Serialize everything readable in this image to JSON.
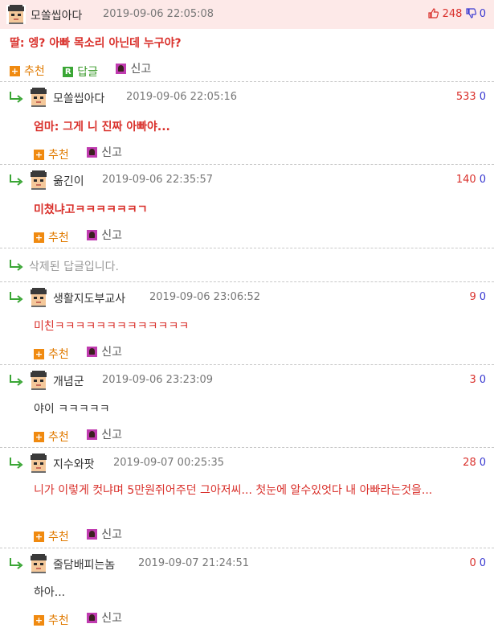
{
  "labels": {
    "recommend": "추천",
    "reply": "답글",
    "report": "신고"
  },
  "colors": {
    "up": "#d9302b",
    "down": "#3b3bd1",
    "top_bg": "#fde9e8"
  },
  "top": {
    "nick": "모쏠씹아다",
    "date": "2019-09-06 22:05:08",
    "up": "248",
    "down": "0",
    "text": "딸: 엥? 아빠 목소리 아닌데 누구야?"
  },
  "replies": [
    {
      "nick": "모쏠씹아다",
      "date": "2019-09-06 22:05:16",
      "up": "533",
      "down": "0",
      "text": "엄마: 그게 니 진짜 아빠야..."
    },
    {
      "nick": "옮긴이",
      "date": "2019-09-06 22:35:57",
      "up": "140",
      "down": "0",
      "text": "미쳤냐고ㅋㅋㅋㅋㅋㅋㄱ"
    },
    {
      "deleted_text": "삭제된 답글입니다."
    },
    {
      "nick": "생활지도부교사",
      "date": "2019-09-06 23:06:52",
      "up": "9",
      "down": "0",
      "text": "미친ㅋㅋㅋㅋㅋㅋㅋㅋㅋㅋㅋㅋㅋ"
    },
    {
      "nick": "개념군",
      "date": "2019-09-06 23:23:09",
      "up": "3",
      "down": "0",
      "text": "야이 ㅋㅋㅋㅋㅋ"
    },
    {
      "nick": "지수와팟",
      "date": "2019-09-07 00:25:35",
      "up": "28",
      "down": "0",
      "text": "니가 이렇게 컷냐며 5만원쥐어주던 그아저씨... 첫눈에 알수있엇다 내 아빠라는것을..."
    },
    {
      "nick": "줄담배피는놈",
      "date": "2019-09-07 21:24:51",
      "up": "0",
      "down": "0",
      "text": "하아..."
    }
  ]
}
